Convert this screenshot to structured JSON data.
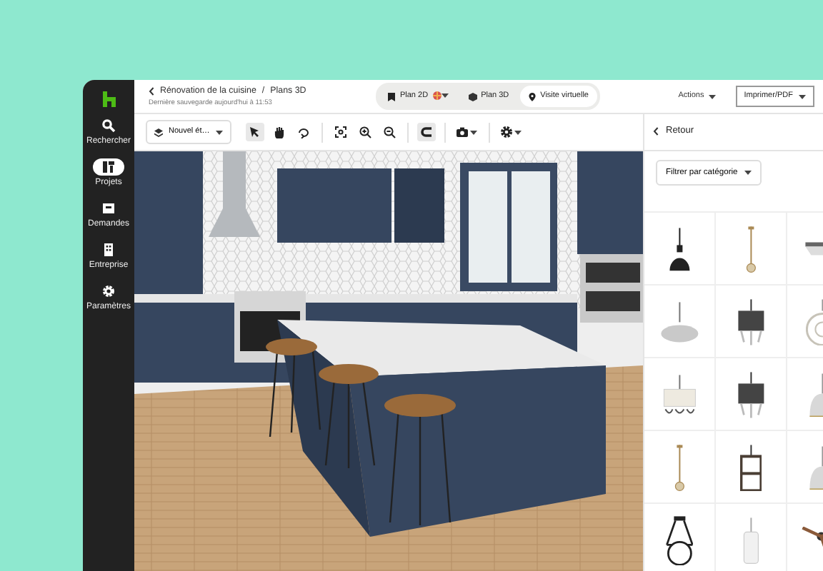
{
  "sidebar": {
    "items": [
      {
        "label": "Rechercher",
        "kind": "search",
        "selected": false
      },
      {
        "label": "Projets",
        "kind": "projects",
        "selected": true
      },
      {
        "label": "Demandes",
        "kind": "requests",
        "selected": false
      },
      {
        "label": "Entreprise",
        "kind": "company",
        "selected": false
      },
      {
        "label": "Paramètres",
        "kind": "settings",
        "selected": false
      }
    ]
  },
  "header": {
    "breadcrumb": [
      "Rénovation de la cuisine",
      "Plans 3D"
    ],
    "breadcrumb_separator": "/",
    "subtitle": "Dernière sauvegarde aujourd'hui à 11:53",
    "views": [
      {
        "label": "Plan 2D",
        "kind": "plan2d",
        "selected": false
      },
      {
        "label": "Plan 3D",
        "kind": "plan3d",
        "selected": false
      },
      {
        "label": "Visite virtuelle",
        "kind": "tour",
        "selected": true
      }
    ],
    "actions": "Actions",
    "print": "Imprimer/PDF"
  },
  "toolbar": {
    "floor": "Nouvel ét…",
    "tools": [
      {
        "kind": "pointer",
        "selected": true
      },
      {
        "kind": "hand",
        "selected": false
      },
      {
        "kind": "rotate",
        "selected": false
      },
      {
        "kind": "fit",
        "selected": false
      },
      {
        "kind": "zoom-in",
        "selected": false
      },
      {
        "kind": "zoom-out",
        "selected": false
      },
      {
        "kind": "magnet",
        "selected": true
      },
      {
        "kind": "camera",
        "selected": false
      },
      {
        "kind": "gear",
        "selected": false
      }
    ]
  },
  "panel": {
    "back": "Retour",
    "filter": "Filtrer par catégorie",
    "products": [
      {
        "kind": "dome"
      },
      {
        "kind": "pendant"
      },
      {
        "kind": "ceiling"
      },
      {
        "kind": "saucer"
      },
      {
        "kind": "chandelier"
      },
      {
        "kind": "orb"
      },
      {
        "kind": "drum"
      },
      {
        "kind": "chandelier"
      },
      {
        "kind": "bell"
      },
      {
        "kind": "pendant"
      },
      {
        "kind": "lantern"
      },
      {
        "kind": "bell"
      },
      {
        "kind": "globe"
      },
      {
        "kind": "cylinder"
      },
      {
        "kind": "fan"
      }
    ]
  }
}
